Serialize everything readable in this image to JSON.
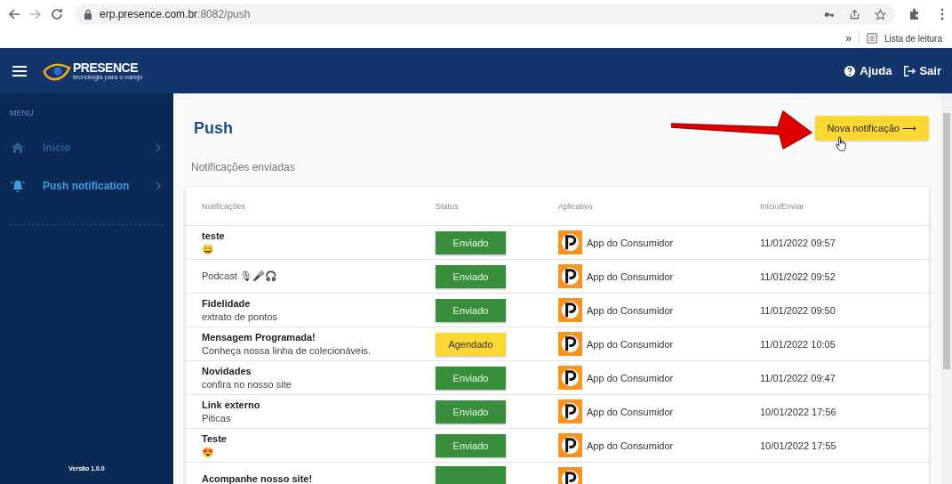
{
  "browser": {
    "url_host": "erp.presence.com.br",
    "url_rest": ":8082/push",
    "overflow": "»",
    "reading_list": "Lista de leitura"
  },
  "header": {
    "brand": "PRESENCE",
    "tagline": "tecnologia para o varejo",
    "help": "Ajuda",
    "logout": "Sair"
  },
  "sidebar": {
    "section": "MENU",
    "items": [
      {
        "label": "Início",
        "selected": false
      },
      {
        "label": "Push notification",
        "selected": true
      }
    ],
    "version": "Versão 1.0.0"
  },
  "page": {
    "title": "Push",
    "new_button": "Nova notificação",
    "new_button_arrow": "⟶",
    "subtitle": "Notificações enviadas"
  },
  "table": {
    "columns": [
      "Notificações",
      "Status",
      "Aplicativo",
      "Início/Enviar"
    ],
    "rows": [
      {
        "title": "teste",
        "body": "😄",
        "status": "Enviado",
        "kind": "sent",
        "app": "App do Consumidor",
        "date": "11/01/2022 09:57"
      },
      {
        "body": "Podcast 🎙🎤🎧",
        "status": "Enviado",
        "kind": "sent",
        "app": "App do Consumidor",
        "date": "11/01/2022 09:52"
      },
      {
        "title": "Fidelidade",
        "body": "extrato de pontos",
        "status": "Enviado",
        "kind": "sent",
        "app": "App do Consumidor",
        "date": "11/01/2022 09:50"
      },
      {
        "title": "Mensagem Programada!",
        "body": "Conheça nossa linha de colecionáveis.",
        "status": "Agendado",
        "kind": "scheduled",
        "app": "App do Consumidor",
        "date": "11/01/2022 10:05"
      },
      {
        "title": "Novidades",
        "body": "confira no nosso site",
        "status": "Enviado",
        "kind": "sent",
        "app": "App do Consumidor",
        "date": "11/01/2022 09:47"
      },
      {
        "title": "Link externo",
        "body": "Piticas",
        "status": "Enviado",
        "kind": "sent",
        "app": "App do Consumidor",
        "date": "10/01/2022 17:56"
      },
      {
        "title": "Teste",
        "body": "😍",
        "status": "Enviado",
        "kind": "sent",
        "app": "App do Consumidor",
        "date": "10/01/2022 17:55"
      },
      {
        "title": "Acompanhe nosso site!",
        "kind": "sent"
      }
    ]
  }
}
